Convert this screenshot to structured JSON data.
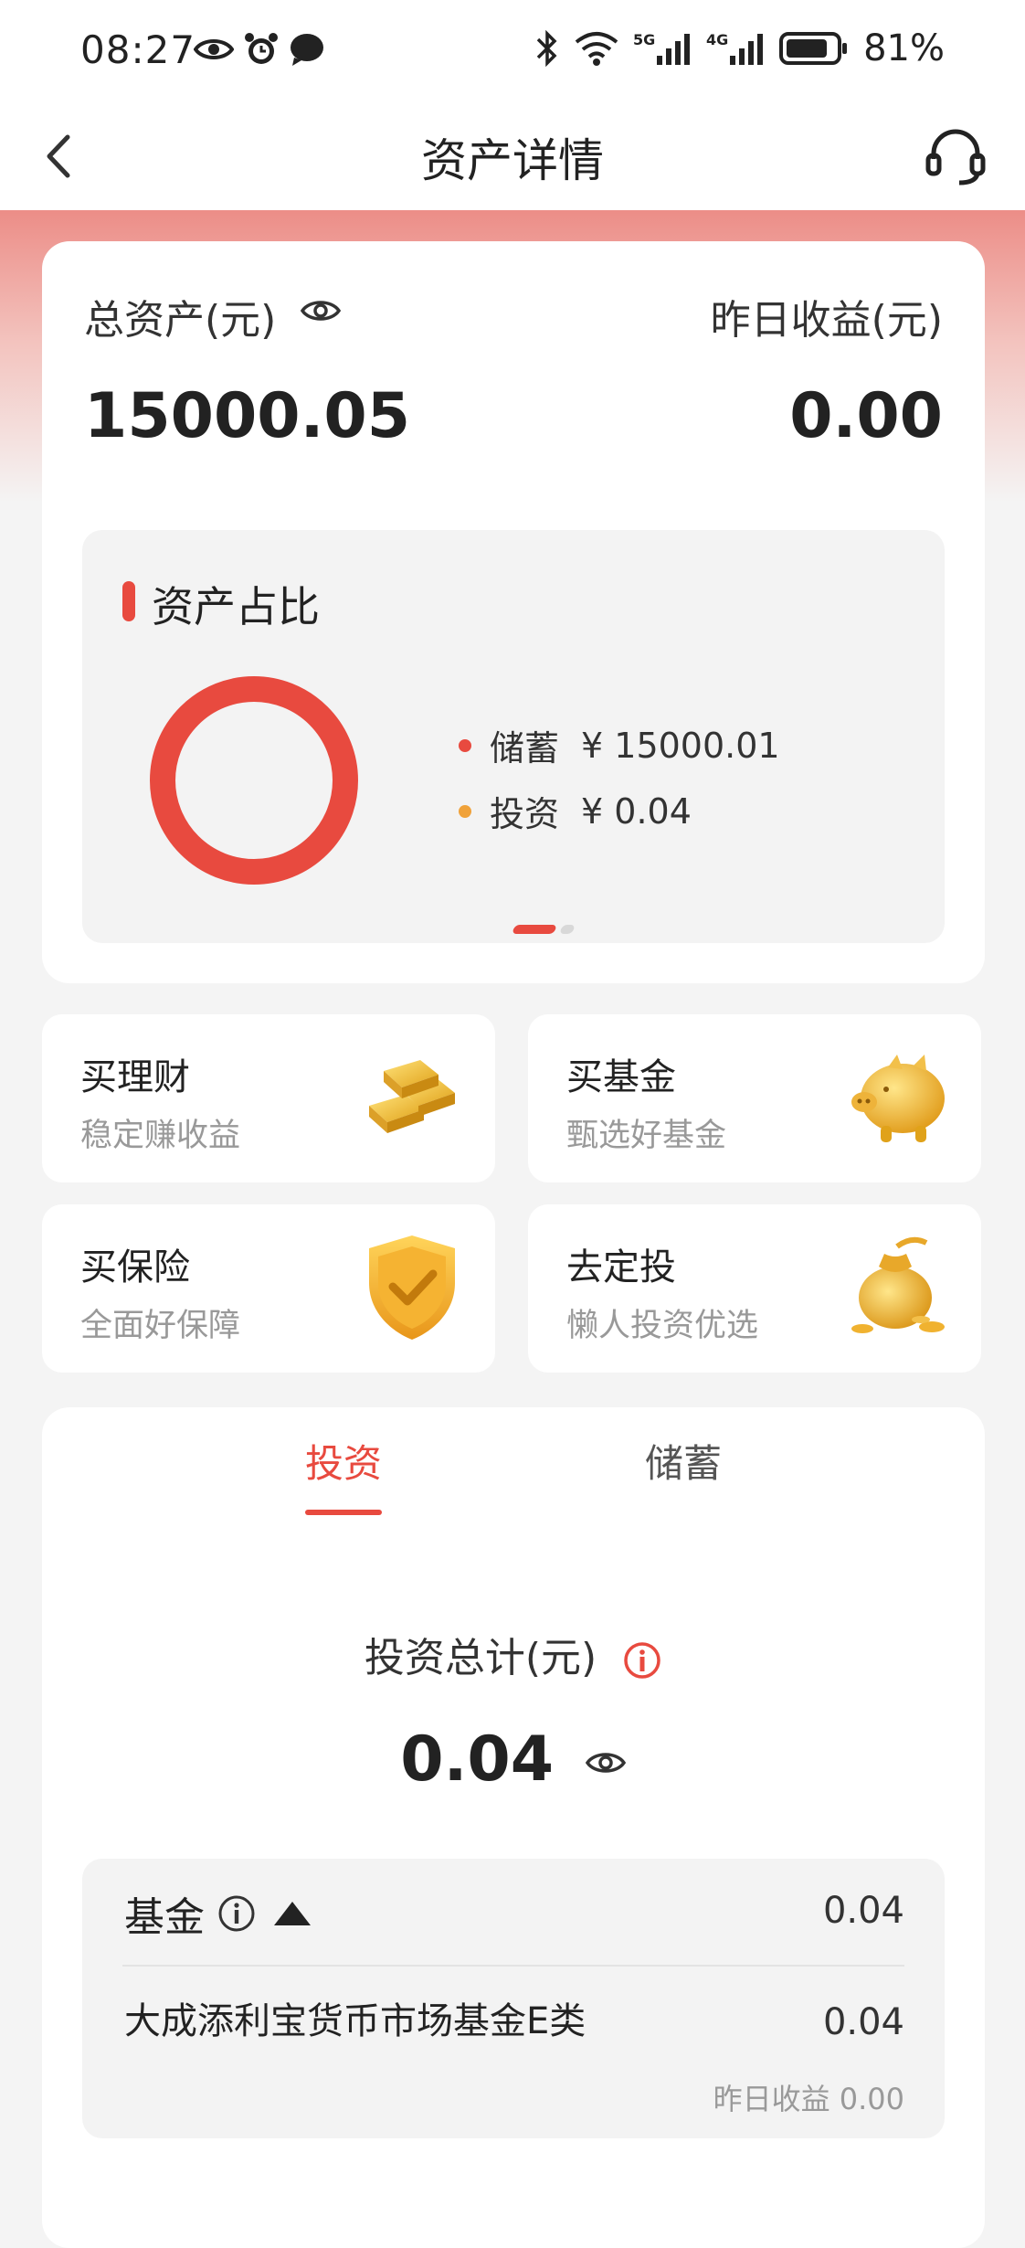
{
  "status_bar": {
    "time": "08:27",
    "battery": "81%"
  },
  "nav": {
    "title": "资产详情"
  },
  "summary": {
    "total_label": "总资产(元)",
    "total_value": "15000.05",
    "yesterday_label": "昨日收益(元)",
    "yesterday_value": "0.00"
  },
  "ratio": {
    "title": "资产占比",
    "items": [
      {
        "name": "储蓄",
        "amount": "¥ 15000.01",
        "color": "#e84a3f"
      },
      {
        "name": "投资",
        "amount": "¥ 0.04",
        "color": "#f0a23a"
      }
    ]
  },
  "quick": [
    {
      "title": "买理财",
      "sub": "稳定赚收益",
      "icon": "gold-bars-icon"
    },
    {
      "title": "买基金",
      "sub": "甄选好基金",
      "icon": "piggy-bank-icon"
    },
    {
      "title": "买保险",
      "sub": "全面好保障",
      "icon": "shield-check-icon"
    },
    {
      "title": "去定投",
      "sub": "懒人投资优选",
      "icon": "money-bag-icon"
    }
  ],
  "tabs": {
    "invest": "投资",
    "savings": "储蓄"
  },
  "invest": {
    "total_label": "投资总计(元)",
    "total_value": "0.04",
    "group_label": "基金",
    "group_value": "0.04",
    "fund_name": "大成添利宝货币市场基金E类",
    "fund_value": "0.04",
    "fund_yesterday": "昨日收益 0.00"
  },
  "colors": {
    "accent": "#e84a3f",
    "secondary": "#f0a23a"
  }
}
